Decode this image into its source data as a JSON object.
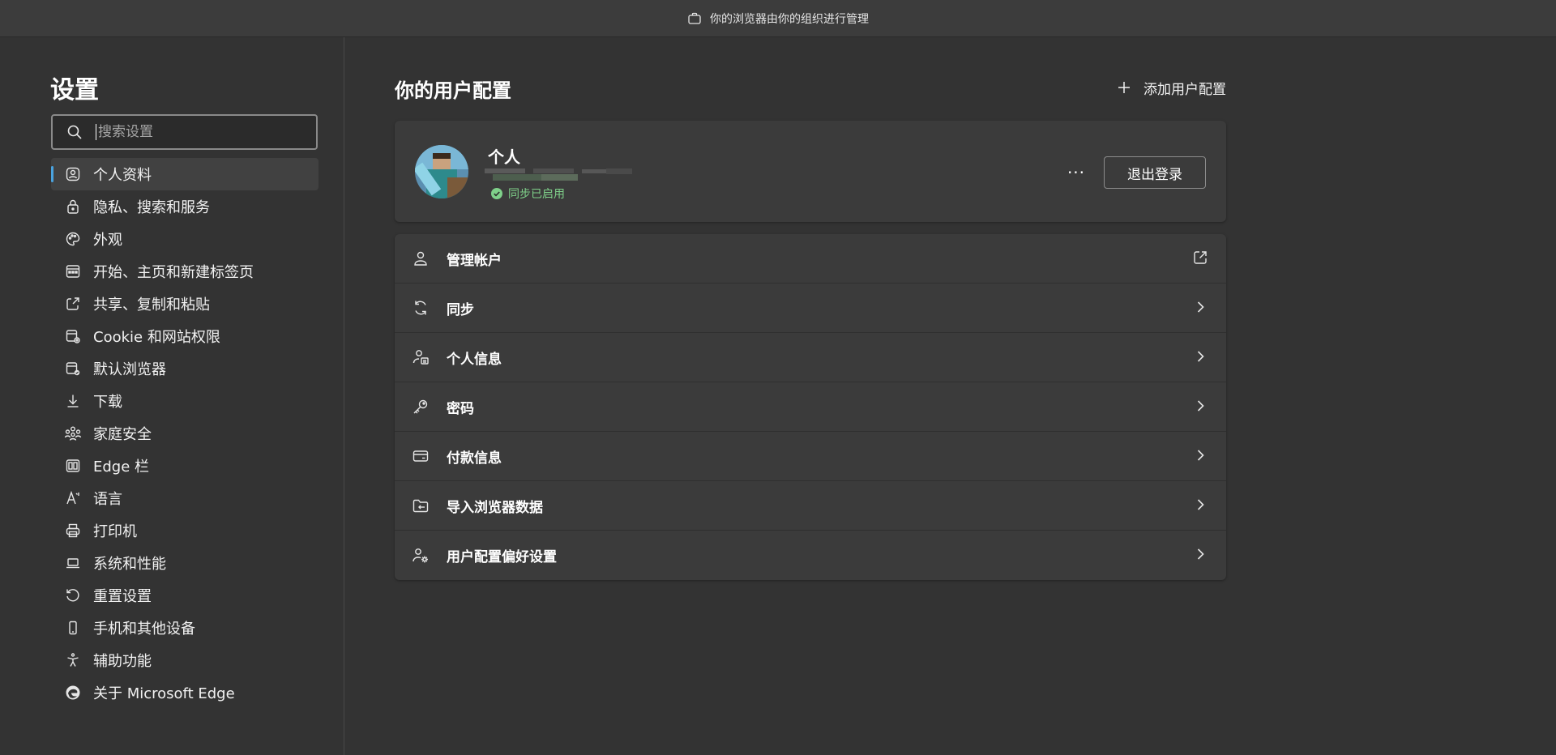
{
  "banner": {
    "text": "你的浏览器由你的组织进行管理",
    "icon": "briefcase-icon"
  },
  "sidebar": {
    "title": "设置",
    "search": {
      "placeholder": "搜索设置",
      "value": ""
    },
    "items": [
      {
        "label": "个人资料",
        "icon": "profile-icon",
        "active": true
      },
      {
        "label": "隐私、搜索和服务",
        "icon": "lock-icon"
      },
      {
        "label": "外观",
        "icon": "palette-icon"
      },
      {
        "label": "开始、主页和新建标签页",
        "icon": "newtab-icon"
      },
      {
        "label": "共享、复制和粘贴",
        "icon": "share-icon"
      },
      {
        "label": "Cookie 和网站权限",
        "icon": "site-permissions-icon"
      },
      {
        "label": "默认浏览器",
        "icon": "default-browser-icon"
      },
      {
        "label": "下载",
        "icon": "download-icon"
      },
      {
        "label": "家庭安全",
        "icon": "family-icon"
      },
      {
        "label": "Edge 栏",
        "icon": "edge-bar-icon"
      },
      {
        "label": "语言",
        "icon": "language-icon"
      },
      {
        "label": "打印机",
        "icon": "printer-icon"
      },
      {
        "label": "系统和性能",
        "icon": "laptop-icon"
      },
      {
        "label": "重置设置",
        "icon": "reset-icon"
      },
      {
        "label": "手机和其他设备",
        "icon": "phone-icon"
      },
      {
        "label": "辅助功能",
        "icon": "accessibility-icon"
      },
      {
        "label": "关于 Microsoft Edge",
        "icon": "edge-logo-icon"
      }
    ]
  },
  "main": {
    "title": "你的用户配置",
    "add_profile": "添加用户配置",
    "profile": {
      "name": "个人",
      "sync_status": "同步已启用",
      "more": "···",
      "sign_out": "退出登录"
    },
    "rows": [
      {
        "label": "管理帐户",
        "icon": "person-icon",
        "trail": "external-link-icon"
      },
      {
        "label": "同步",
        "icon": "sync-icon",
        "trail": "chevron-right-icon"
      },
      {
        "label": "个人信息",
        "icon": "person-card-icon",
        "trail": "chevron-right-icon"
      },
      {
        "label": "密码",
        "icon": "key-icon",
        "trail": "chevron-right-icon"
      },
      {
        "label": "付款信息",
        "icon": "credit-card-icon",
        "trail": "chevron-right-icon"
      },
      {
        "label": "导入浏览器数据",
        "icon": "import-folder-icon",
        "trail": "chevron-right-icon"
      },
      {
        "label": "用户配置偏好设置",
        "icon": "profile-settings-icon",
        "trail": "chevron-right-icon"
      }
    ]
  },
  "colors": {
    "background": "#333333",
    "accent": "#4aa3df",
    "sync_green": "#7fd18a"
  }
}
